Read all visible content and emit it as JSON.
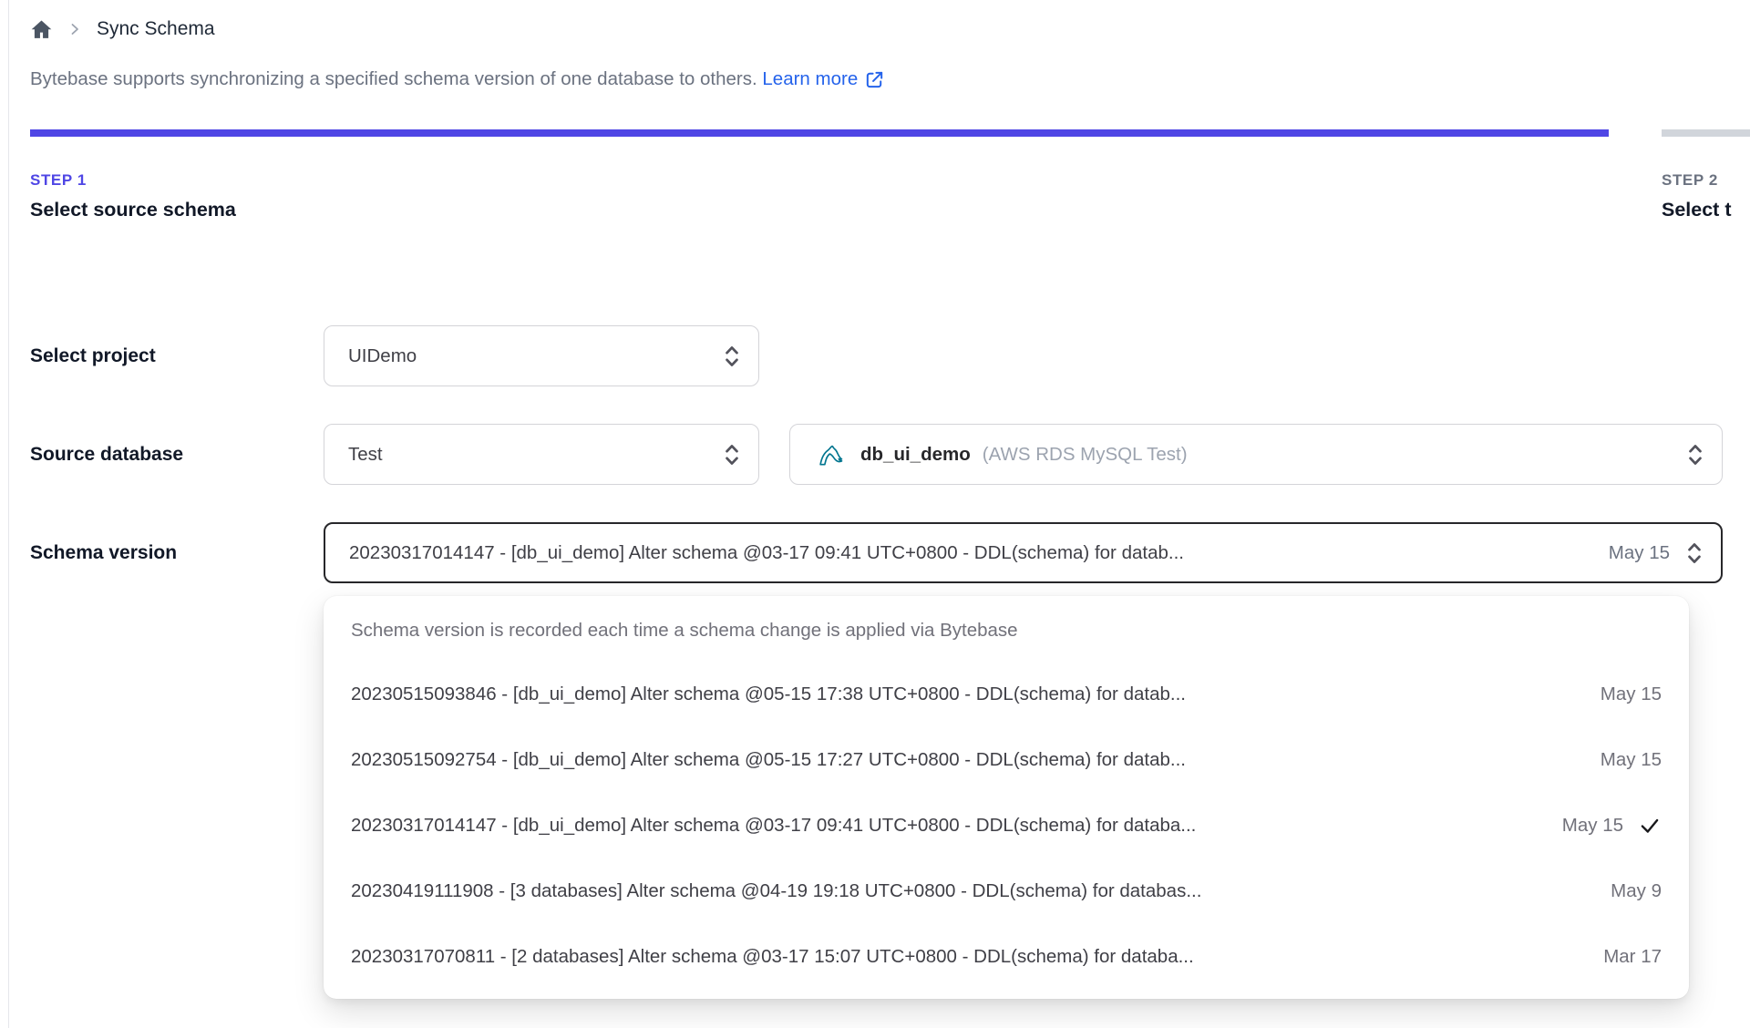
{
  "breadcrumb": {
    "title": "Sync Schema"
  },
  "intro": {
    "text": "Bytebase supports synchronizing a specified schema version of one database to others.",
    "link_label": "Learn more"
  },
  "steps": [
    {
      "label": "STEP 1",
      "title": "Select source schema",
      "state": "active"
    },
    {
      "label": "STEP 2",
      "title": "Select t",
      "state": "inactive"
    }
  ],
  "form": {
    "project": {
      "label": "Select project",
      "value": "UIDemo"
    },
    "source_database": {
      "label": "Source database",
      "environment": "Test",
      "database_name": "db_ui_demo",
      "database_info": "(AWS RDS MySQL Test)"
    },
    "schema_version": {
      "label": "Schema version",
      "value": "20230317014147 - [db_ui_demo] Alter schema @03-17 09:41 UTC+0800 - DDL(schema) for datab...",
      "date": "May 15"
    }
  },
  "dropdown": {
    "hint": "Schema version is recorded each time a schema change is applied via Bytebase",
    "options": [
      {
        "text": "20230515093846 - [db_ui_demo] Alter schema @05-15 17:38 UTC+0800 - DDL(schema) for datab...",
        "date": "May 15",
        "selected": false
      },
      {
        "text": "20230515092754 - [db_ui_demo] Alter schema @05-15 17:27 UTC+0800 - DDL(schema) for datab...",
        "date": "May 15",
        "selected": false
      },
      {
        "text": "20230317014147 - [db_ui_demo] Alter schema @03-17 09:41 UTC+0800 - DDL(schema) for databa...",
        "date": "May 15",
        "selected": true
      },
      {
        "text": "20230419111908 - [3 databases] Alter schema @04-19 19:18 UTC+0800 - DDL(schema) for databas...",
        "date": "May 9",
        "selected": false
      },
      {
        "text": "20230317070811 - [2 databases] Alter schema @03-17 15:07 UTC+0800 - DDL(schema) for databa...",
        "date": "Mar 17",
        "selected": false
      }
    ]
  },
  "colors": {
    "accent": "#4f46e5",
    "link": "#2563eb",
    "border": "#d4d4d8",
    "border-focus": "#27272a",
    "bar-inactive": "#d1d5db",
    "icon-gray": "#52525b",
    "mysql": "#00758f"
  }
}
